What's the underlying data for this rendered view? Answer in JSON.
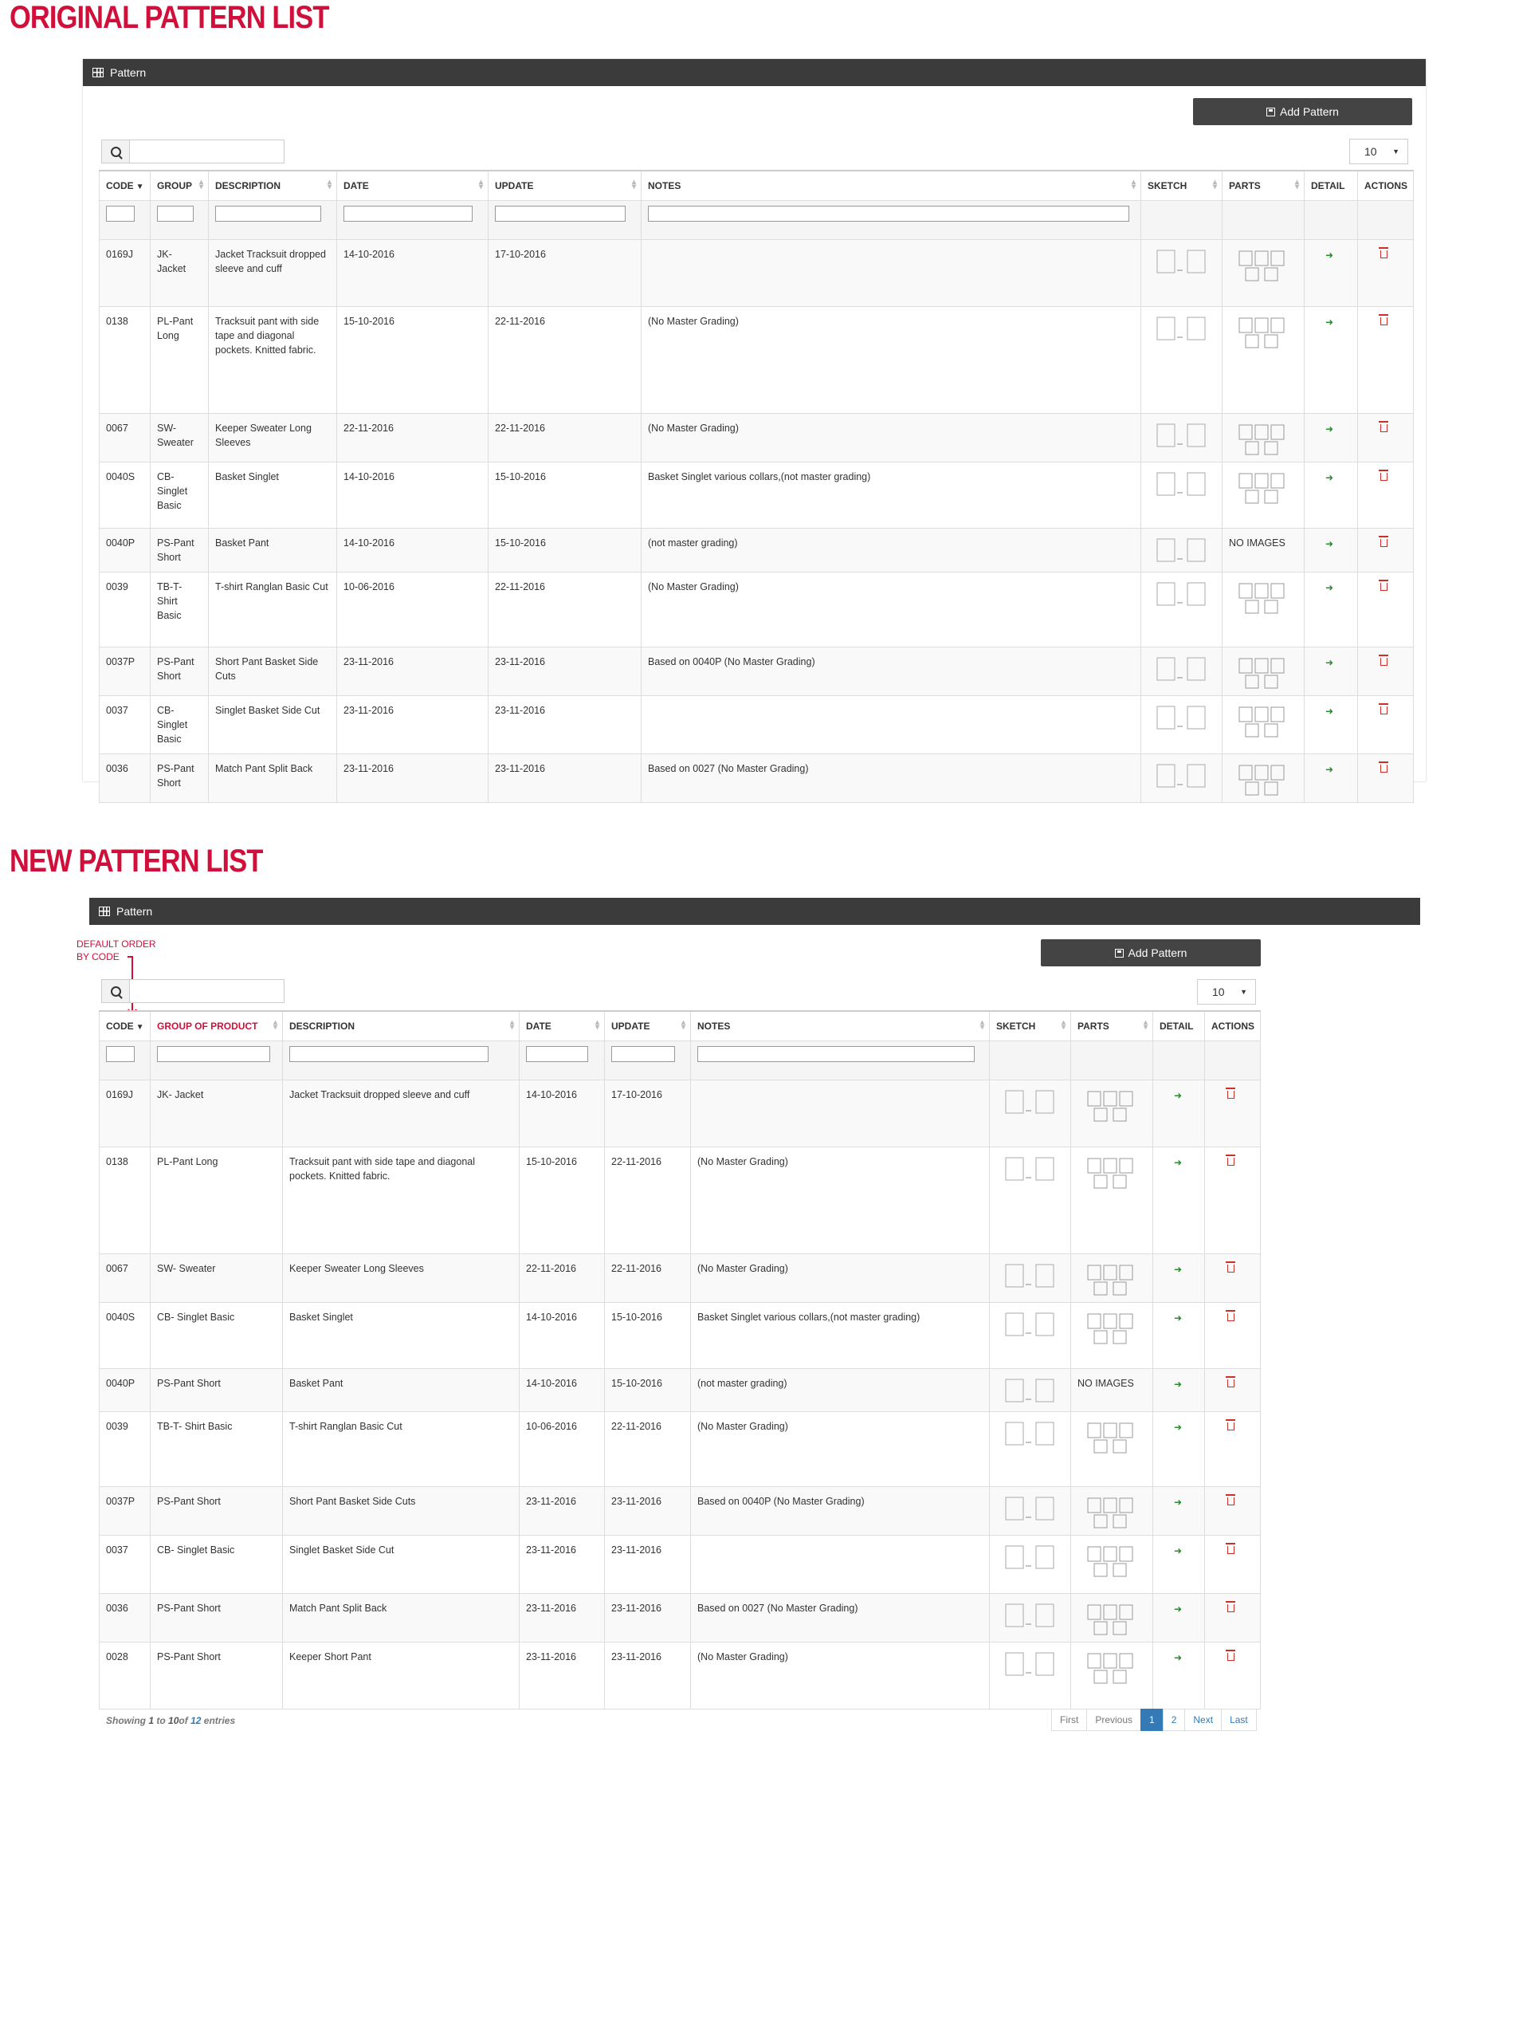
{
  "headings": {
    "original": "ORIGINAL PATTERN LIST",
    "new": "NEW PATTERN LIST"
  },
  "panel": {
    "title": "Pattern",
    "add_button": "Add Pattern",
    "page_length": "10",
    "search_placeholder": ""
  },
  "annotation": {
    "line1": "DEFAULT ORDER",
    "line2": "BY CODE"
  },
  "original_columns": [
    "CODE",
    "GROUP",
    "DESCRIPTION",
    "DATE",
    "UPDATE",
    "NOTES",
    "SKETCH",
    "PARTS",
    "DETAIL",
    "ACTIONS"
  ],
  "new_columns": [
    "CODE",
    "GROUP OF PRODUCT",
    "DESCRIPTION",
    "DATE",
    "UPDATE",
    "NOTES",
    "SKETCH",
    "PARTS",
    "DETAIL",
    "ACTIONS"
  ],
  "original_rows": [
    {
      "code": "0169J",
      "group": "JK-\nJacket",
      "description": "Jacket Tracksuit dropped sleeve and cuff",
      "date": "14-10-2016",
      "update": "17-10-2016",
      "notes": "",
      "parts": ""
    },
    {
      "code": "0138",
      "group": "PL-Pant\nLong",
      "description": "Tracksuit pant with side tape and diagonal pockets. Knitted fabric.",
      "date": "15-10-2016",
      "update": "22-11-2016",
      "notes": "(No Master Grading)",
      "parts": ""
    },
    {
      "code": "0067",
      "group": "SW-\nSweater",
      "description": "Keeper Sweater Long Sleeves",
      "date": "22-11-2016",
      "update": "22-11-2016",
      "notes": "(No Master Grading)",
      "parts": ""
    },
    {
      "code": "0040S",
      "group": "CB-\nSinglet\nBasic",
      "description": "Basket Singlet",
      "date": "14-10-2016",
      "update": "15-10-2016",
      "notes": "Basket Singlet various collars,(not master grading)",
      "parts": ""
    },
    {
      "code": "0040P",
      "group": "PS-Pant\nShort",
      "description": "Basket Pant",
      "date": "14-10-2016",
      "update": "15-10-2016",
      "notes": "(not master grading)",
      "parts": "NO IMAGES"
    },
    {
      "code": "0039",
      "group": "TB-T-\nShirt\nBasic",
      "description": "T-shirt Ranglan Basic Cut",
      "date": "10-06-2016",
      "update": "22-11-2016",
      "notes": "(No Master Grading)",
      "parts": ""
    },
    {
      "code": "0037P",
      "group": "PS-Pant\nShort",
      "description": "Short Pant Basket Side Cuts",
      "date": "23-11-2016",
      "update": "23-11-2016",
      "notes": "Based on 0040P (No Master Grading)",
      "parts": ""
    },
    {
      "code": "0037",
      "group": "CB-\nSinglet\nBasic",
      "description": "Singlet Basket Side Cut",
      "date": "23-11-2016",
      "update": "23-11-2016",
      "notes": "",
      "parts": ""
    },
    {
      "code": "0036",
      "group": "PS-Pant\nShort",
      "description": "Match Pant Split Back",
      "date": "23-11-2016",
      "update": "23-11-2016",
      "notes": "Based on 0027 (No Master Grading)",
      "parts": ""
    }
  ],
  "new_rows": [
    {
      "code": "0169J",
      "group": "JK- Jacket",
      "description": "Jacket Tracksuit  dropped sleeve and  cuff",
      "date": "14-10-2016",
      "update": "17-10-2016",
      "notes": "",
      "parts": ""
    },
    {
      "code": "0138",
      "group": "PL-Pant Long",
      "description": "Tracksuit pant with side  tape and diagonal pockets. Knitted fabric.",
      "date": "15-10-2016",
      "update": "22-11-2016",
      "notes": "(No Master Grading)",
      "parts": ""
    },
    {
      "code": "0067",
      "group": "SW- Sweater",
      "description": "Keeper Sweater Long  Sleeves",
      "date": "22-11-2016",
      "update": "22-11-2016",
      "notes": "(No Master Grading)",
      "parts": ""
    },
    {
      "code": "0040S",
      "group": "CB- Singlet Basic",
      "description": "Basket Singlet",
      "date": "14-10-2016",
      "update": "15-10-2016",
      "notes": "Basket Singlet various collars,(not master grading)",
      "parts": ""
    },
    {
      "code": "0040P",
      "group": "PS-Pant Short",
      "description": "Basket Pant",
      "date": "14-10-2016",
      "update": "15-10-2016",
      "notes": "(not master grading)",
      "parts": "NO IMAGES"
    },
    {
      "code": "0039",
      "group": "TB-T-  Shirt  Basic",
      "description": "T-shirt Ranglan Basic Cut",
      "date": "10-06-2016",
      "update": "22-11-2016",
      "notes": "(No Master Grading)",
      "parts": ""
    },
    {
      "code": "0037P",
      "group": "PS-Pant  Short",
      "description": "Short Pant Basket Side Cuts",
      "date": "23-11-2016",
      "update": "23-11-2016",
      "notes": "Based on 0040P (No Master Grading)",
      "parts": ""
    },
    {
      "code": "0037",
      "group": "CB-  Singlet Basic",
      "description": "Singlet Basket Side Cut",
      "date": "23-11-2016",
      "update": "23-11-2016",
      "notes": "",
      "parts": ""
    },
    {
      "code": "0036",
      "group": "PS-Pant  Short",
      "description": "Match Pant Split Back",
      "date": "23-11-2016",
      "update": "23-11-2016",
      "notes": "Based on 0027 (No Master Grading)",
      "parts": ""
    },
    {
      "code": "0028",
      "group": "PS-Pant Short",
      "description": "Keeper Short Pant",
      "date": "23-11-2016",
      "update": "23-11-2016",
      "notes": "(No Master Grading)",
      "parts": ""
    }
  ],
  "footer": {
    "showing": "Showing",
    "from": "1",
    "to_word": "to",
    "to": "10",
    "of_word": "of",
    "total": "12",
    "entries": "entries"
  },
  "pagination": [
    "First",
    "Previous",
    "1",
    "2",
    "Next",
    "Last"
  ],
  "colors": {
    "heading": "#d0103a",
    "panel_header": "#3b3b3b",
    "active_page": "#337ab7"
  }
}
